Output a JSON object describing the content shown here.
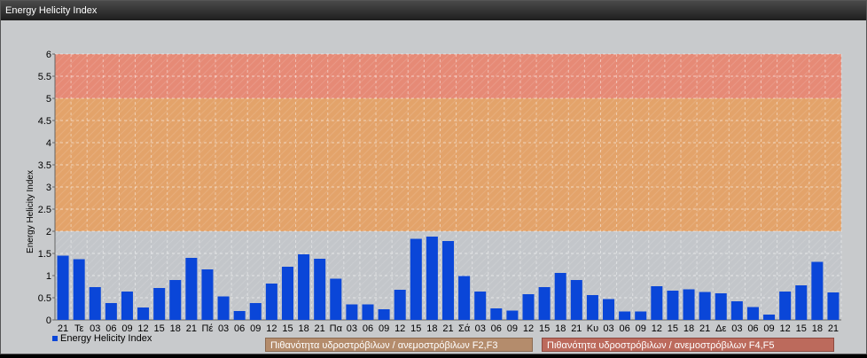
{
  "window": {
    "title": "Energy Helicity Index"
  },
  "colors": {
    "bar": "#0a46d8",
    "zone_low": "#c3c6ca",
    "zone_mid": "#e3a36a",
    "zone_high": "#e68a76",
    "legend_mid": "#b48c6c",
    "legend_high": "#bc6a5c"
  },
  "chart_data": {
    "type": "bar",
    "ylabel": "Energy Helicity Index",
    "ylim": [
      0,
      6
    ],
    "yticks": [
      "0",
      "0.5",
      "1",
      "1.5",
      "2",
      "2.5",
      "3",
      "3.5",
      "4",
      "4.5",
      "5",
      "5.5",
      "6"
    ],
    "grid": true,
    "categories": [
      "21",
      "Τε",
      "03",
      "06",
      "09",
      "12",
      "15",
      "18",
      "21",
      "Πέ",
      "03",
      "06",
      "09",
      "12",
      "15",
      "18",
      "21",
      "Πα",
      "03",
      "06",
      "09",
      "12",
      "15",
      "18",
      "21",
      "Σά",
      "03",
      "06",
      "09",
      "12",
      "15",
      "18",
      "21",
      "Κυ",
      "03",
      "06",
      "09",
      "12",
      "15",
      "18",
      "21",
      "Δε",
      "03",
      "06",
      "09",
      "12",
      "15",
      "18",
      "21"
    ],
    "series": [
      {
        "name": "Energy Helicity Index",
        "values": [
          1.45,
          1.37,
          0.74,
          0.38,
          0.64,
          0.28,
          0.72,
          0.9,
          1.4,
          1.14,
          0.53,
          0.2,
          0.38,
          0.82,
          1.2,
          1.48,
          1.38,
          0.93,
          0.35,
          0.35,
          0.24,
          0.68,
          1.83,
          1.88,
          1.78,
          0.99,
          0.64,
          0.26,
          0.21,
          0.58,
          0.74,
          1.06,
          0.9,
          0.56,
          0.47,
          0.19,
          0.19,
          0.76,
          0.66,
          0.69,
          0.63,
          0.6,
          0.42,
          0.29,
          0.12,
          0.64,
          0.78,
          1.31,
          0.62
        ]
      }
    ],
    "zones": [
      {
        "from": 2,
        "to": 5,
        "label": "Πιθανότητα υδροστρόβιλων / ανεμοστρόβιλων F2,F3"
      },
      {
        "from": 5,
        "to": 6,
        "label": "Πιθανότητα υδροστρόβιλων / ανεμοστρόβιλων F4,F5"
      }
    ],
    "legend": {
      "placement": "bottom-left",
      "series_label": "Energy Helicity Index",
      "zone_mid_label": "Πιθανότητα υδροστρόβιλων / ανεμοστρόβιλων F2,F3",
      "zone_high_label": "Πιθανότητα υδροστρόβιλων / ανεμοστρόβιλων F4,F5"
    }
  }
}
